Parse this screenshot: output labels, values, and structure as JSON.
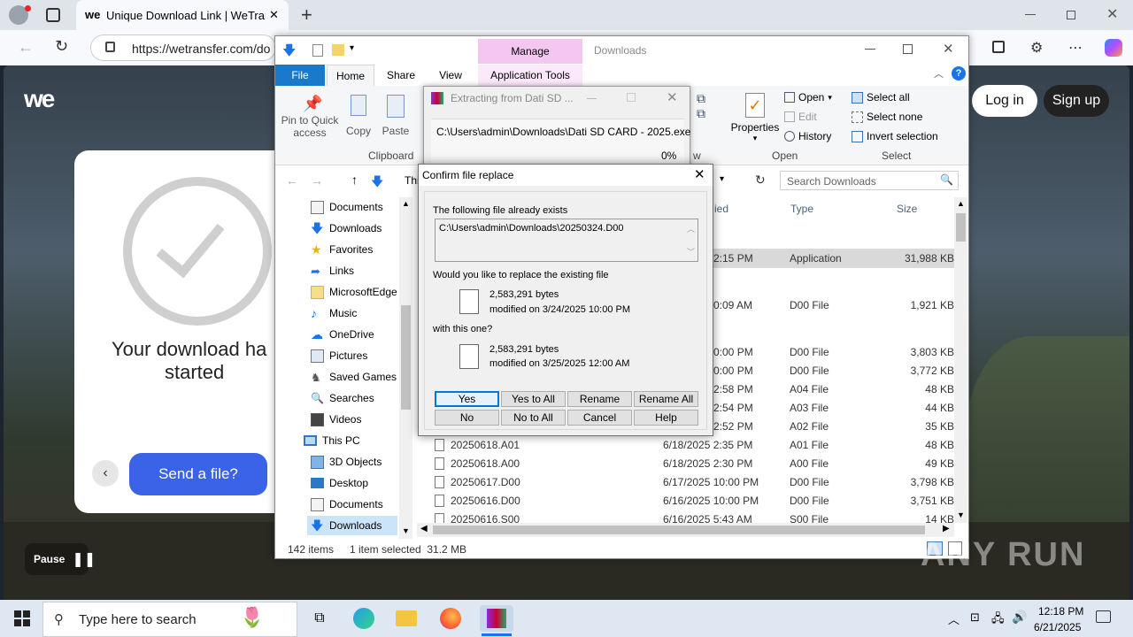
{
  "browser": {
    "tab_title": "Unique Download Link | WeTransf",
    "url": "https://wetransfer.com/do",
    "tab_close": "✕",
    "new_tab": "+"
  },
  "wetransfer": {
    "logo": "we",
    "download_title_line1": "Your download ha",
    "download_title_line2": "started",
    "send_button": "Send a file?",
    "login": "Log in",
    "signup": "Sign up",
    "pause_label": "Pause"
  },
  "explorer": {
    "ribbon_context_header": "Manage",
    "window_title": "Downloads",
    "tabs": [
      "File",
      "Home",
      "Share",
      "View",
      "Application Tools"
    ],
    "clipboard": {
      "pin": "Pin to Quick access",
      "copy": "Copy",
      "paste": "Paste",
      "label": "Clipboard"
    },
    "organize_label": "w",
    "open_group": {
      "properties": "Properties",
      "open": "Open",
      "edit": "Edit",
      "history": "History",
      "label": "Open"
    },
    "select_group": {
      "select_all": "Select all",
      "select_none": "Select none",
      "invert": "Invert selection",
      "label": "Select"
    },
    "search_placeholder": "Search Downloads",
    "address_fragment": "Thi",
    "columns": {
      "date": "ied",
      "type": "Type",
      "size": "Size"
    },
    "nav_items": [
      "Documents",
      "Downloads",
      "Favorites",
      "Links",
      "MicrosoftEdge",
      "Music",
      "OneDrive",
      "Pictures",
      "Saved Games",
      "Searches",
      "Videos",
      "This PC",
      "3D Objects",
      "Desktop",
      "Documents",
      "Downloads"
    ],
    "files": [
      {
        "name": "",
        "date": "2:15 PM",
        "type": "Application",
        "size": "31,988 KB"
      },
      {
        "name": "",
        "date": "0:09 AM",
        "type": "D00 File",
        "size": "1,921 KB"
      },
      {
        "name": "",
        "date": "0:00 PM",
        "type": "D00 File",
        "size": "3,803 KB"
      },
      {
        "name": "",
        "date": "0:00 PM",
        "type": "D00 File",
        "size": "3,772 KB"
      },
      {
        "name": "",
        "date": "2:58 PM",
        "type": "A04 File",
        "size": "48 KB"
      },
      {
        "name": "",
        "date": "2:54 PM",
        "type": "A03 File",
        "size": "44 KB"
      },
      {
        "name": "",
        "date": "2:52 PM",
        "type": "A02 File",
        "size": "35 KB"
      },
      {
        "name": "20250618.A01",
        "date": "6/18/2025 2:35 PM",
        "type": "A01 File",
        "size": "48 KB"
      },
      {
        "name": "20250618.A00",
        "date": "6/18/2025 2:30 PM",
        "type": "A00 File",
        "size": "49 KB"
      },
      {
        "name": "20250617.D00",
        "date": "6/17/2025 10:00 PM",
        "type": "D00 File",
        "size": "3,798 KB"
      },
      {
        "name": "20250616.D00",
        "date": "6/16/2025 10:00 PM",
        "type": "D00 File",
        "size": "3,751 KB"
      },
      {
        "name": "20250616.S00",
        "date": "6/16/2025 5:43 AM",
        "type": "S00 File",
        "size": "14 KB"
      }
    ],
    "status_items": "142 items",
    "status_selected": "1 item selected  31.2 MB"
  },
  "extract_dialog": {
    "title": "Extracting from Dati SD ...",
    "path": "C:\\Users\\admin\\Downloads\\Dati SD CARD - 2025.exe",
    "percent": "0%"
  },
  "confirm_dialog": {
    "title": "Confirm file replace",
    "exists_label": "The following file already exists",
    "file_path": "C:\\Users\\admin\\Downloads\\20250324.D00",
    "question": "Would you like to replace the existing file",
    "existing_size": "2,583,291 bytes",
    "existing_modified": "modified on 3/24/2025 10:00 PM",
    "with_label": "with this one?",
    "new_size": "2,583,291 bytes",
    "new_modified": "modified on 3/25/2025 12:00 AM",
    "buttons": [
      "Yes",
      "Yes to All",
      "Rename",
      "Rename All",
      "No",
      "No to All",
      "Cancel",
      "Help"
    ]
  },
  "taskbar": {
    "search_placeholder": "Type here to search",
    "time": "12:18 PM",
    "date": "6/21/2025"
  },
  "watermark": "ANY RUN"
}
